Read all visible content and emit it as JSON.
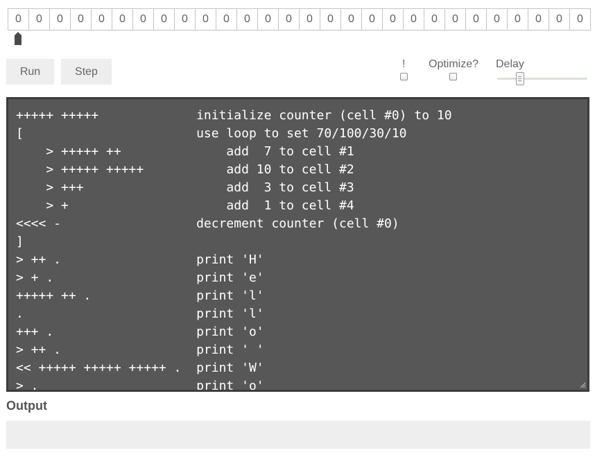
{
  "tape": {
    "cells": [
      "0",
      "0",
      "0",
      "0",
      "0",
      "0",
      "0",
      "0",
      "0",
      "0",
      "0",
      "0",
      "0",
      "0",
      "0",
      "0",
      "0",
      "0",
      "0",
      "0",
      "0",
      "0",
      "0",
      "0",
      "0",
      "0",
      "0",
      "0"
    ],
    "pointer_index": 0
  },
  "controls": {
    "run_label": "Run",
    "step_label": "Step",
    "bang_label": "!",
    "bang_checked": false,
    "optimize_label": "Optimize?",
    "optimize_checked": false,
    "delay_label": "Delay",
    "delay_value": 0.25
  },
  "editor": {
    "code": "+++++ +++++             initialize counter (cell #0) to 10\n[                       use loop to set 70/100/30/10\n    > +++++ ++              add  7 to cell #1\n    > +++++ +++++           add 10 to cell #2\n    > +++                   add  3 to cell #3\n    > +                     add  1 to cell #4\n<<<< -                  decrement counter (cell #0)\n]\n> ++ .                  print 'H'\n> + .                   print 'e'\n+++++ ++ .              print 'l'\n.                       print 'l'\n+++ .                   print 'o'\n> ++ .                  print ' '\n<< +++++ +++++ +++++ .  print 'W'\n> .                     print 'o'"
  },
  "output": {
    "label": "Output",
    "value": ""
  },
  "icons": {
    "pointer": "tape-pointer-icon",
    "resize": "resize-grip-icon"
  },
  "colors": {
    "editor_bg": "#575757",
    "editor_border": "#3c3c3c",
    "button_bg": "#eeeeee",
    "output_bg": "#eeeeee"
  }
}
